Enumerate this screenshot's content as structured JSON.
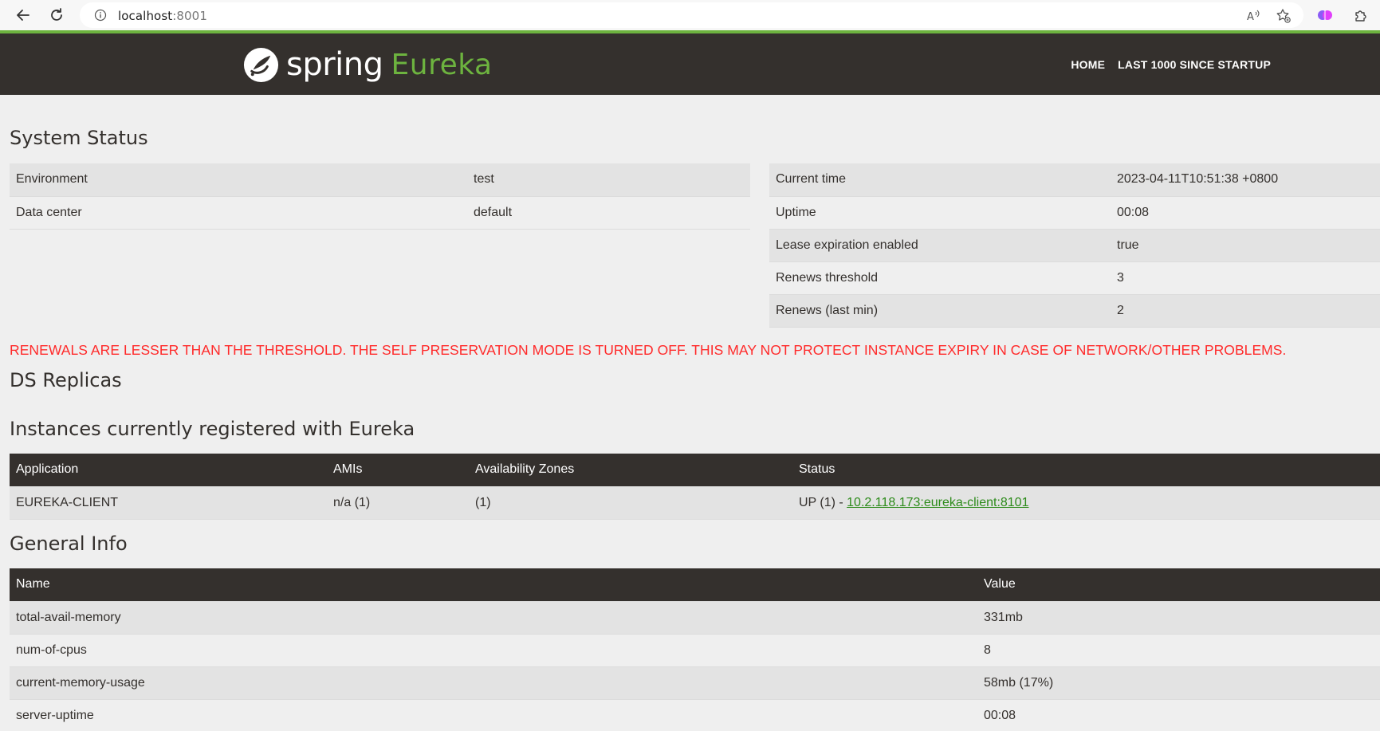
{
  "browser": {
    "url_host": "localhost",
    "url_port": ":8001"
  },
  "header": {
    "logo_spring": "spring",
    "logo_eureka": "Eureka",
    "nav": [
      "HOME",
      "LAST 1000 SINCE STARTUP"
    ]
  },
  "system_status": {
    "title": "System Status",
    "left": [
      {
        "label": "Environment",
        "value": "test"
      },
      {
        "label": "Data center",
        "value": "default"
      }
    ],
    "right": [
      {
        "label": "Current time",
        "value": "2023-04-11T10:51:38 +0800"
      },
      {
        "label": "Uptime",
        "value": "00:08"
      },
      {
        "label": "Lease expiration enabled",
        "value": "true"
      },
      {
        "label": "Renews threshold",
        "value": "3"
      },
      {
        "label": "Renews (last min)",
        "value": "2"
      }
    ]
  },
  "warning": "RENEWALS ARE LESSER THAN THE THRESHOLD. THE SELF PRESERVATION MODE IS TURNED OFF. THIS MAY NOT PROTECT INSTANCE EXPIRY IN CASE OF NETWORK/OTHER PROBLEMS.",
  "ds_replicas": {
    "title": "DS Replicas"
  },
  "instances": {
    "title": "Instances currently registered with Eureka",
    "headers": [
      "Application",
      "AMIs",
      "Availability Zones",
      "Status"
    ],
    "rows": [
      {
        "application": "EUREKA-CLIENT",
        "amis": "n/a (1)",
        "zones": "(1)",
        "status_prefix": "UP (1) - ",
        "status_link": "10.2.118.173:eureka-client:8101"
      }
    ]
  },
  "general_info": {
    "title": "General Info",
    "headers": [
      "Name",
      "Value"
    ],
    "rows": [
      {
        "name": "total-avail-memory",
        "value": "331mb"
      },
      {
        "name": "num-of-cpus",
        "value": "8"
      },
      {
        "name": "current-memory-usage",
        "value": "58mb (17%)"
      },
      {
        "name": "server-uptime",
        "value": "00:08"
      }
    ]
  }
}
